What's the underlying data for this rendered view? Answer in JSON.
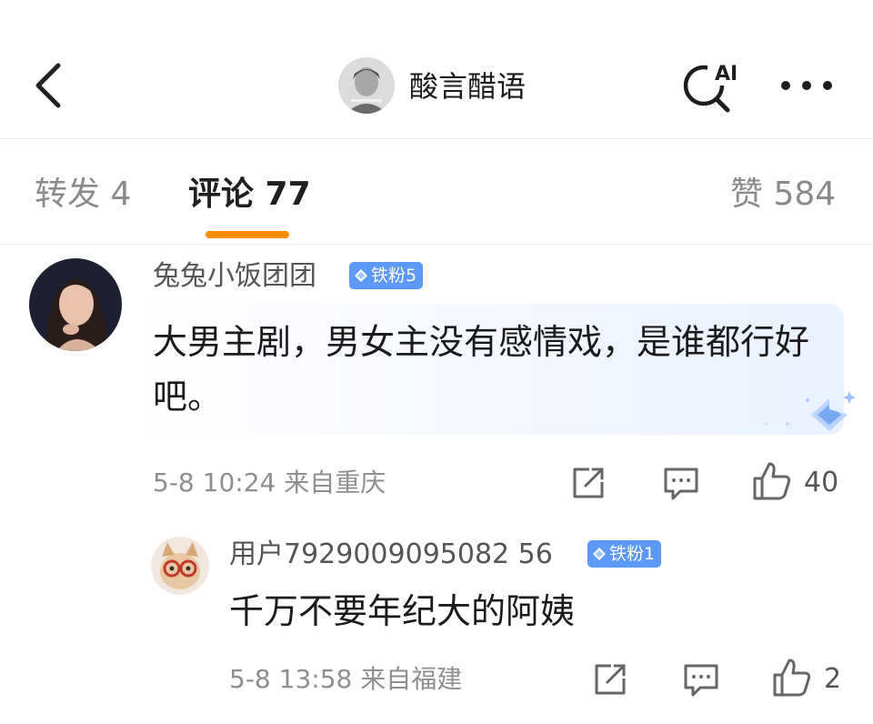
{
  "header": {
    "title": "酸言醋语"
  },
  "tabs": [
    {
      "label": "转发 4"
    },
    {
      "label": "评论 77"
    },
    {
      "label": "赞 584"
    }
  ],
  "comment": {
    "user": "兔兔小饭团团",
    "badge": "铁粉5",
    "text": "大男主剧，男女主没有感情戏，是谁都行好吧。",
    "time": "5-8 10:24",
    "location": "来自重庆",
    "likes": "40",
    "reply": {
      "user": "用户7929009095082 56",
      "badge": "铁粉1",
      "text": "千万不要年纪大的阿姨",
      "time": "5-8 13:58",
      "location": "来自福建",
      "likes": "2"
    }
  },
  "icons": [
    "back-arrow-icon",
    "ai-search-icon",
    "more-icon",
    "share-icon",
    "comment-icon",
    "like-icon",
    "diamond-icon"
  ]
}
